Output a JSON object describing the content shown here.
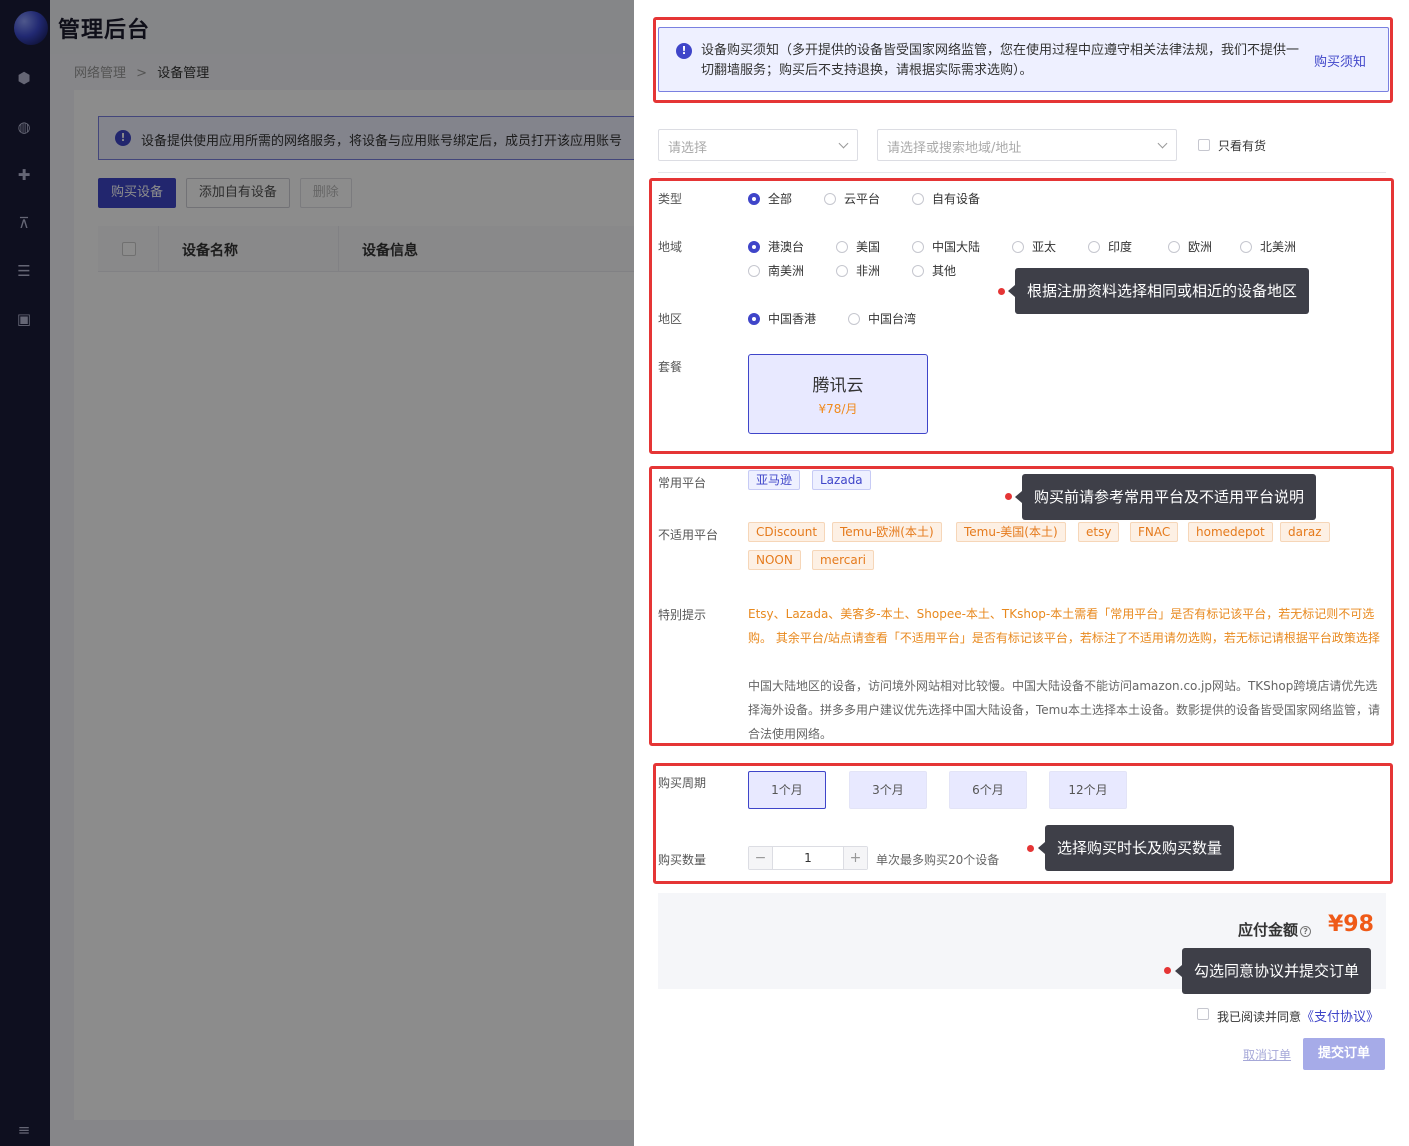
{
  "app": {
    "title": "管理后台"
  },
  "breadcrumb": {
    "parent": "网络管理",
    "separator": ">",
    "current": "设备管理"
  },
  "main_notice": "设备提供使用应用所需的网络服务，将设备与应用账号绑定后，成员打开该应用账号",
  "toolbar": {
    "buy": "购买设备",
    "add_own": "添加自有设备",
    "delete": "删除"
  },
  "table": {
    "columns": [
      "设备名称",
      "设备信息"
    ]
  },
  "drawer": {
    "purchase_notice": {
      "text": "设备购买须知（多开提供的设备皆受国家网络监管，您在使用过程中应遵守相关法律法规，我们不提供一切翻墙服务；购买后不支持退换，请根据实际需求选购）。",
      "link": "购买须知"
    },
    "filters": {
      "select_placeholder": "请选择",
      "region_placeholder": "请选择或搜索地域/地址",
      "in_stock_only": "只看有货"
    },
    "type": {
      "label": "类型",
      "options": [
        "全部",
        "云平台",
        "自有设备"
      ],
      "selected": 0
    },
    "region": {
      "label": "地域",
      "options": [
        "港澳台",
        "美国",
        "中国大陆",
        "亚太",
        "印度",
        "欧洲",
        "北美洲",
        "南美洲",
        "非洲",
        "其他"
      ],
      "selected": 0
    },
    "area": {
      "label": "地区",
      "options": [
        "中国香港",
        "中国台湾"
      ],
      "selected": 0
    },
    "plan": {
      "label": "套餐",
      "name": "腾讯云",
      "price": "¥78/月"
    },
    "common_platforms": {
      "label": "常用平台",
      "items": [
        "亚马逊",
        "Lazada"
      ]
    },
    "unsupported_platforms": {
      "label": "不适用平台",
      "items": [
        "CDiscount",
        "Temu-欧洲(本土)",
        "Temu-美国(本土)",
        "etsy",
        "FNAC",
        "homedepot",
        "daraz",
        "NOON",
        "mercari"
      ]
    },
    "special_tip": {
      "label": "特别提示",
      "warn": "Etsy、Lazada、美客多-本土、Shopee-本土、TKshop-本土需看「常用平台」是否有标记该平台，若无标记则不可选购。 其余平台/站点请查看「不适用平台」是否有标记该平台，若标注了不适用请勿选购，若无标记请根据平台政策选择",
      "info": "中国大陆地区的设备，访问境外网站相对比较慢。中国大陆设备不能访问amazon.co.jp网站。TKShop跨境店请优先选择海外设备。拼多多用户建议优先选择中国大陆设备，Temu本土选择本土设备。数影提供的设备皆受国家网络监管，请合法使用网络。"
    },
    "period": {
      "label": "购买周期",
      "options": [
        "1个月",
        "3个月",
        "6个月",
        "12个月"
      ],
      "selected": 0
    },
    "quantity": {
      "label": "购买数量",
      "value": "1",
      "minus": "−",
      "plus": "+",
      "hint": "单次最多购买20个设备"
    },
    "total": {
      "label": "应付金额",
      "help": "?",
      "amount": "¥98"
    },
    "agreement": {
      "text": "我已阅读并同意",
      "link": "《支付协议》"
    },
    "actions": {
      "cancel": "取消订单",
      "submit": "提交订单"
    }
  },
  "tips": {
    "region": "根据注册资料选择相同或相近的设备地区",
    "platform": "购买前请参考常用平台及不适用平台说明",
    "period": "选择购买时长及购买数量",
    "submit": "勾选同意协议并提交订单"
  },
  "colors": {
    "primary": "#3f45c9",
    "highlight": "#e53535",
    "warn": "#e8891e",
    "price": "#ef5a18"
  }
}
